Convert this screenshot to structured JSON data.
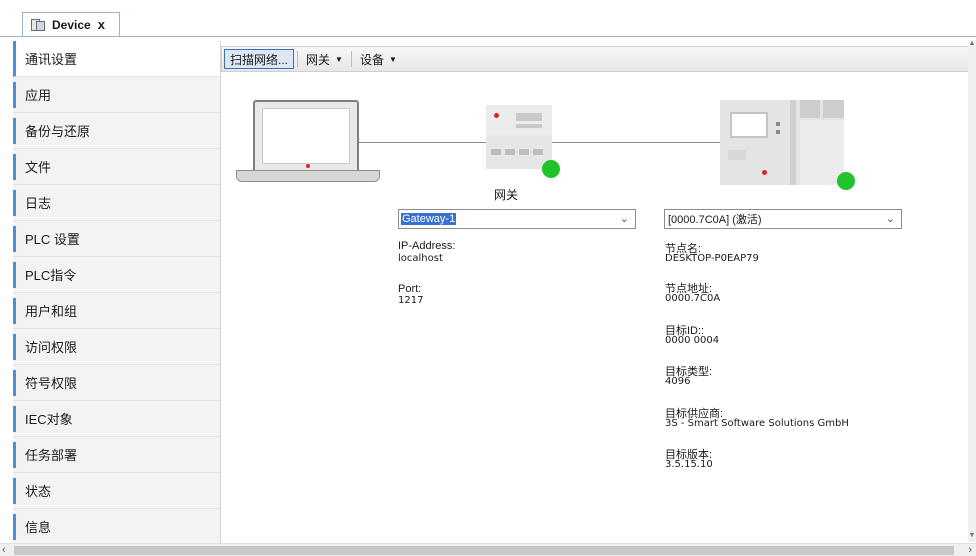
{
  "tab": {
    "title": "Device",
    "close": "x"
  },
  "sidebar": {
    "items": [
      {
        "label": "通讯设置"
      },
      {
        "label": "应用"
      },
      {
        "label": "备份与还原"
      },
      {
        "label": "文件"
      },
      {
        "label": "日志"
      },
      {
        "label": "PLC 设置"
      },
      {
        "label": "PLC指令"
      },
      {
        "label": "用户和组"
      },
      {
        "label": "访问权限"
      },
      {
        "label": "符号权限"
      },
      {
        "label": "IEC对象"
      },
      {
        "label": "任务部署"
      },
      {
        "label": "状态"
      },
      {
        "label": "信息"
      }
    ]
  },
  "toolbar": {
    "scan": "扫描网络...",
    "gateway": "网关",
    "device": "设备"
  },
  "diagram": {
    "gateway_caption": "网关"
  },
  "gateway": {
    "selected": "Gateway-1",
    "ip_label": "IP-Address:",
    "ip_value": "localhost",
    "port_label": "Port:",
    "port_value": "1217"
  },
  "device": {
    "selected": "[0000.7C0A] (激活)",
    "node_name_label": "节点名:",
    "node_name_value": "DESKTOP-P0EAP79",
    "node_addr_label": "节点地址:",
    "node_addr_value": "0000.7C0A",
    "target_id_label": "目标ID::",
    "target_id_value": "0000 0004",
    "target_type_label": "目标类型:",
    "target_type_value": "4096",
    "vendor_label": "目标供应商:",
    "vendor_value": "3S - Smart Software Solutions GmbH",
    "version_label": "目标版本:",
    "version_value": "3.5.15.10"
  },
  "colors": {
    "accent": "#4a90d9",
    "status_ok": "#1fc42a",
    "led_red": "#e52222",
    "selection": "#3872d0"
  }
}
